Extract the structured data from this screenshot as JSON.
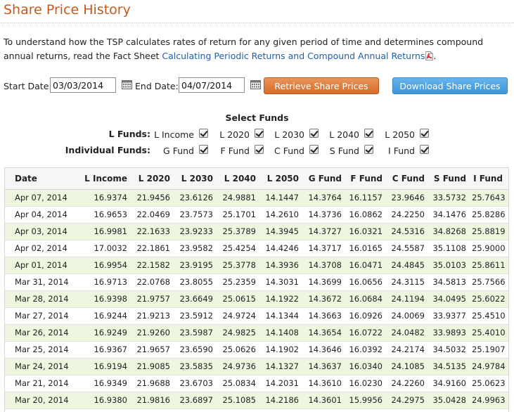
{
  "page": {
    "title": "Share Price History",
    "intro_text": "To understand how the TSP calculates rates of return for any given period of time and determines compound annual returns, read the Fact Sheet ",
    "intro_link": "Calculating Periodic Returns and Compound Annual Returns",
    "intro_end": "."
  },
  "dates": {
    "start_label": "Start Date:",
    "start_value": "03/03/2014",
    "end_label": "End Date:",
    "end_value": "04/07/2014"
  },
  "buttons": {
    "retrieve": "Retrieve Share Prices",
    "download": "Download Share Prices"
  },
  "funds": {
    "title": "Select Funds",
    "l_label": "L Funds:",
    "l_items": [
      {
        "name": "L Income",
        "checked": true
      },
      {
        "name": "L 2020",
        "checked": true
      },
      {
        "name": "L 2030",
        "checked": true
      },
      {
        "name": "L 2040",
        "checked": true
      },
      {
        "name": "L 2050",
        "checked": true
      }
    ],
    "ind_label": "Individual Funds:",
    "ind_items": [
      {
        "name": "G Fund",
        "checked": true
      },
      {
        "name": "F Fund",
        "checked": true
      },
      {
        "name": "C Fund",
        "checked": true
      },
      {
        "name": "S Fund",
        "checked": true
      },
      {
        "name": "I Fund",
        "checked": true
      }
    ]
  },
  "table": {
    "headers": [
      "Date",
      "L Income",
      "L 2020",
      "L 2030",
      "L 2040",
      "L 2050",
      "G Fund",
      "F Fund",
      "C Fund",
      "S Fund",
      "I Fund"
    ],
    "rows": [
      [
        "Apr 07, 2014",
        "16.9374",
        "21.9456",
        "23.6126",
        "24.9881",
        "14.1447",
        "14.3764",
        "16.1157",
        "23.9646",
        "33.5732",
        "25.7643"
      ],
      [
        "Apr 04, 2014",
        "16.9653",
        "22.0469",
        "23.7573",
        "25.1701",
        "14.2610",
        "14.3736",
        "16.0862",
        "24.2250",
        "34.1476",
        "25.8286"
      ],
      [
        "Apr 03, 2014",
        "16.9981",
        "22.1633",
        "23.9233",
        "25.3789",
        "14.3945",
        "14.3727",
        "16.0321",
        "24.5316",
        "34.8268",
        "25.8819"
      ],
      [
        "Apr 02, 2014",
        "17.0032",
        "22.1861",
        "23.9582",
        "25.4254",
        "14.4246",
        "14.3717",
        "16.0165",
        "24.5587",
        "35.1108",
        "25.9000"
      ],
      [
        "Apr 01, 2014",
        "16.9954",
        "22.1582",
        "23.9195",
        "25.3778",
        "14.3936",
        "14.3708",
        "16.0471",
        "24.4845",
        "35.0103",
        "25.8611"
      ],
      [
        "Mar 31, 2014",
        "16.9713",
        "22.0768",
        "23.8055",
        "25.2359",
        "14.3031",
        "14.3699",
        "16.0656",
        "24.3115",
        "34.5813",
        "25.7566"
      ],
      [
        "Mar 28, 2014",
        "16.9398",
        "21.9757",
        "23.6649",
        "25.0615",
        "14.1922",
        "14.3672",
        "16.0684",
        "24.1194",
        "34.0495",
        "25.6022"
      ],
      [
        "Mar 27, 2014",
        "16.9244",
        "21.9213",
        "23.5912",
        "24.9724",
        "14.1344",
        "14.3663",
        "16.0926",
        "24.0069",
        "33.9377",
        "25.4510"
      ],
      [
        "Mar 26, 2014",
        "16.9249",
        "21.9260",
        "23.5987",
        "24.9825",
        "14.1408",
        "14.3654",
        "16.0722",
        "24.0482",
        "33.9893",
        "25.4010"
      ],
      [
        "Mar 25, 2014",
        "16.9367",
        "21.9657",
        "23.6590",
        "25.0626",
        "14.1902",
        "14.3646",
        "16.0392",
        "24.2174",
        "34.5032",
        "25.1907"
      ],
      [
        "Mar 24, 2014",
        "16.9194",
        "21.9085",
        "23.5835",
        "24.9736",
        "14.1327",
        "14.3637",
        "16.0340",
        "24.1085",
        "34.5135",
        "24.9784"
      ],
      [
        "Mar 21, 2014",
        "16.9349",
        "21.9688",
        "23.6703",
        "25.0834",
        "14.2031",
        "14.3610",
        "16.0230",
        "24.2260",
        "34.9160",
        "25.0623"
      ],
      [
        "Mar 20, 2014",
        "16.9380",
        "21.9816",
        "23.6897",
        "25.1085",
        "14.2186",
        "14.3601",
        "15.9956",
        "24.2975",
        "35.0428",
        "24.9963"
      ]
    ]
  }
}
